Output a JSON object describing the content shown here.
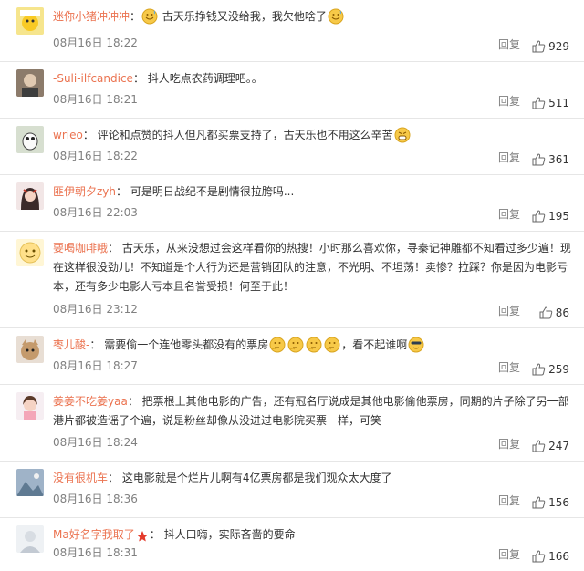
{
  "ui": {
    "reply_label": "回复"
  },
  "comments": [
    {
      "user": "迷你小猪冲冲冲",
      "sep": "：",
      "text": "古天乐挣钱又没给我，我欠他啥了",
      "time": "08月16日 18:22",
      "likes": "929"
    },
    {
      "user": "-Suli-ilfcandice",
      "sep": "：",
      "text": "抖人吃点农药调理吧。。",
      "time": "08月16日 18:21",
      "likes": "511"
    },
    {
      "user": "wrieo",
      "sep": "：",
      "text": "评论和点赞的抖人但凡都买票支持了，古天乐也不用这么辛苦",
      "time": "08月16日 18:22",
      "likes": "361"
    },
    {
      "user": "匪伊朝夕zyh",
      "sep": "：",
      "text": "可是明日战纪不是剧情很拉胯吗...",
      "time": "08月16日 22:03",
      "likes": "195"
    },
    {
      "user": "要喝咖啡哦",
      "sep": "：",
      "text": "古天乐，从来没想过会这样看你的热搜！小时那么喜欢你，寻秦记神雕都不知看过多少遍！现在这样很没劲儿！不知道是个人行为还是营销团队的注意，不光明、不坦荡！卖惨？拉踩？你是因为电影亏本，还有多少电影人亏本且名誉受损！何至于此！",
      "time": "08月16日 23:12",
      "likes": "86"
    },
    {
      "user": "枣儿酸-",
      "sep": "：",
      "text_a": "需要偷一个连他零头都没有的票房",
      "text_b": "，看不起谁啊",
      "time": "08月16日 18:27",
      "likes": "259"
    },
    {
      "user": "姜姜不吃姜yaa",
      "sep": "：",
      "text": "把票根上其他电影的广告，还有冠名厅说成是其他电影偷他票房，同期的片子除了另一部港片都被造谣了个遍，说是粉丝却像从没进过电影院买票一样，可笑",
      "time": "08月16日 18:24",
      "likes": "247"
    },
    {
      "user": "没有很机车",
      "sep": "：",
      "text": "这电影就是个烂片儿啊有4亿票房都是我们观众太大度了",
      "time": "08月16日 18:36",
      "likes": "156"
    },
    {
      "user": "Ma好名字我取了",
      "sep": "：",
      "text": "抖人口嗨，实际吝啬的要命",
      "time": "08月16日 18:31",
      "likes": "166"
    }
  ]
}
